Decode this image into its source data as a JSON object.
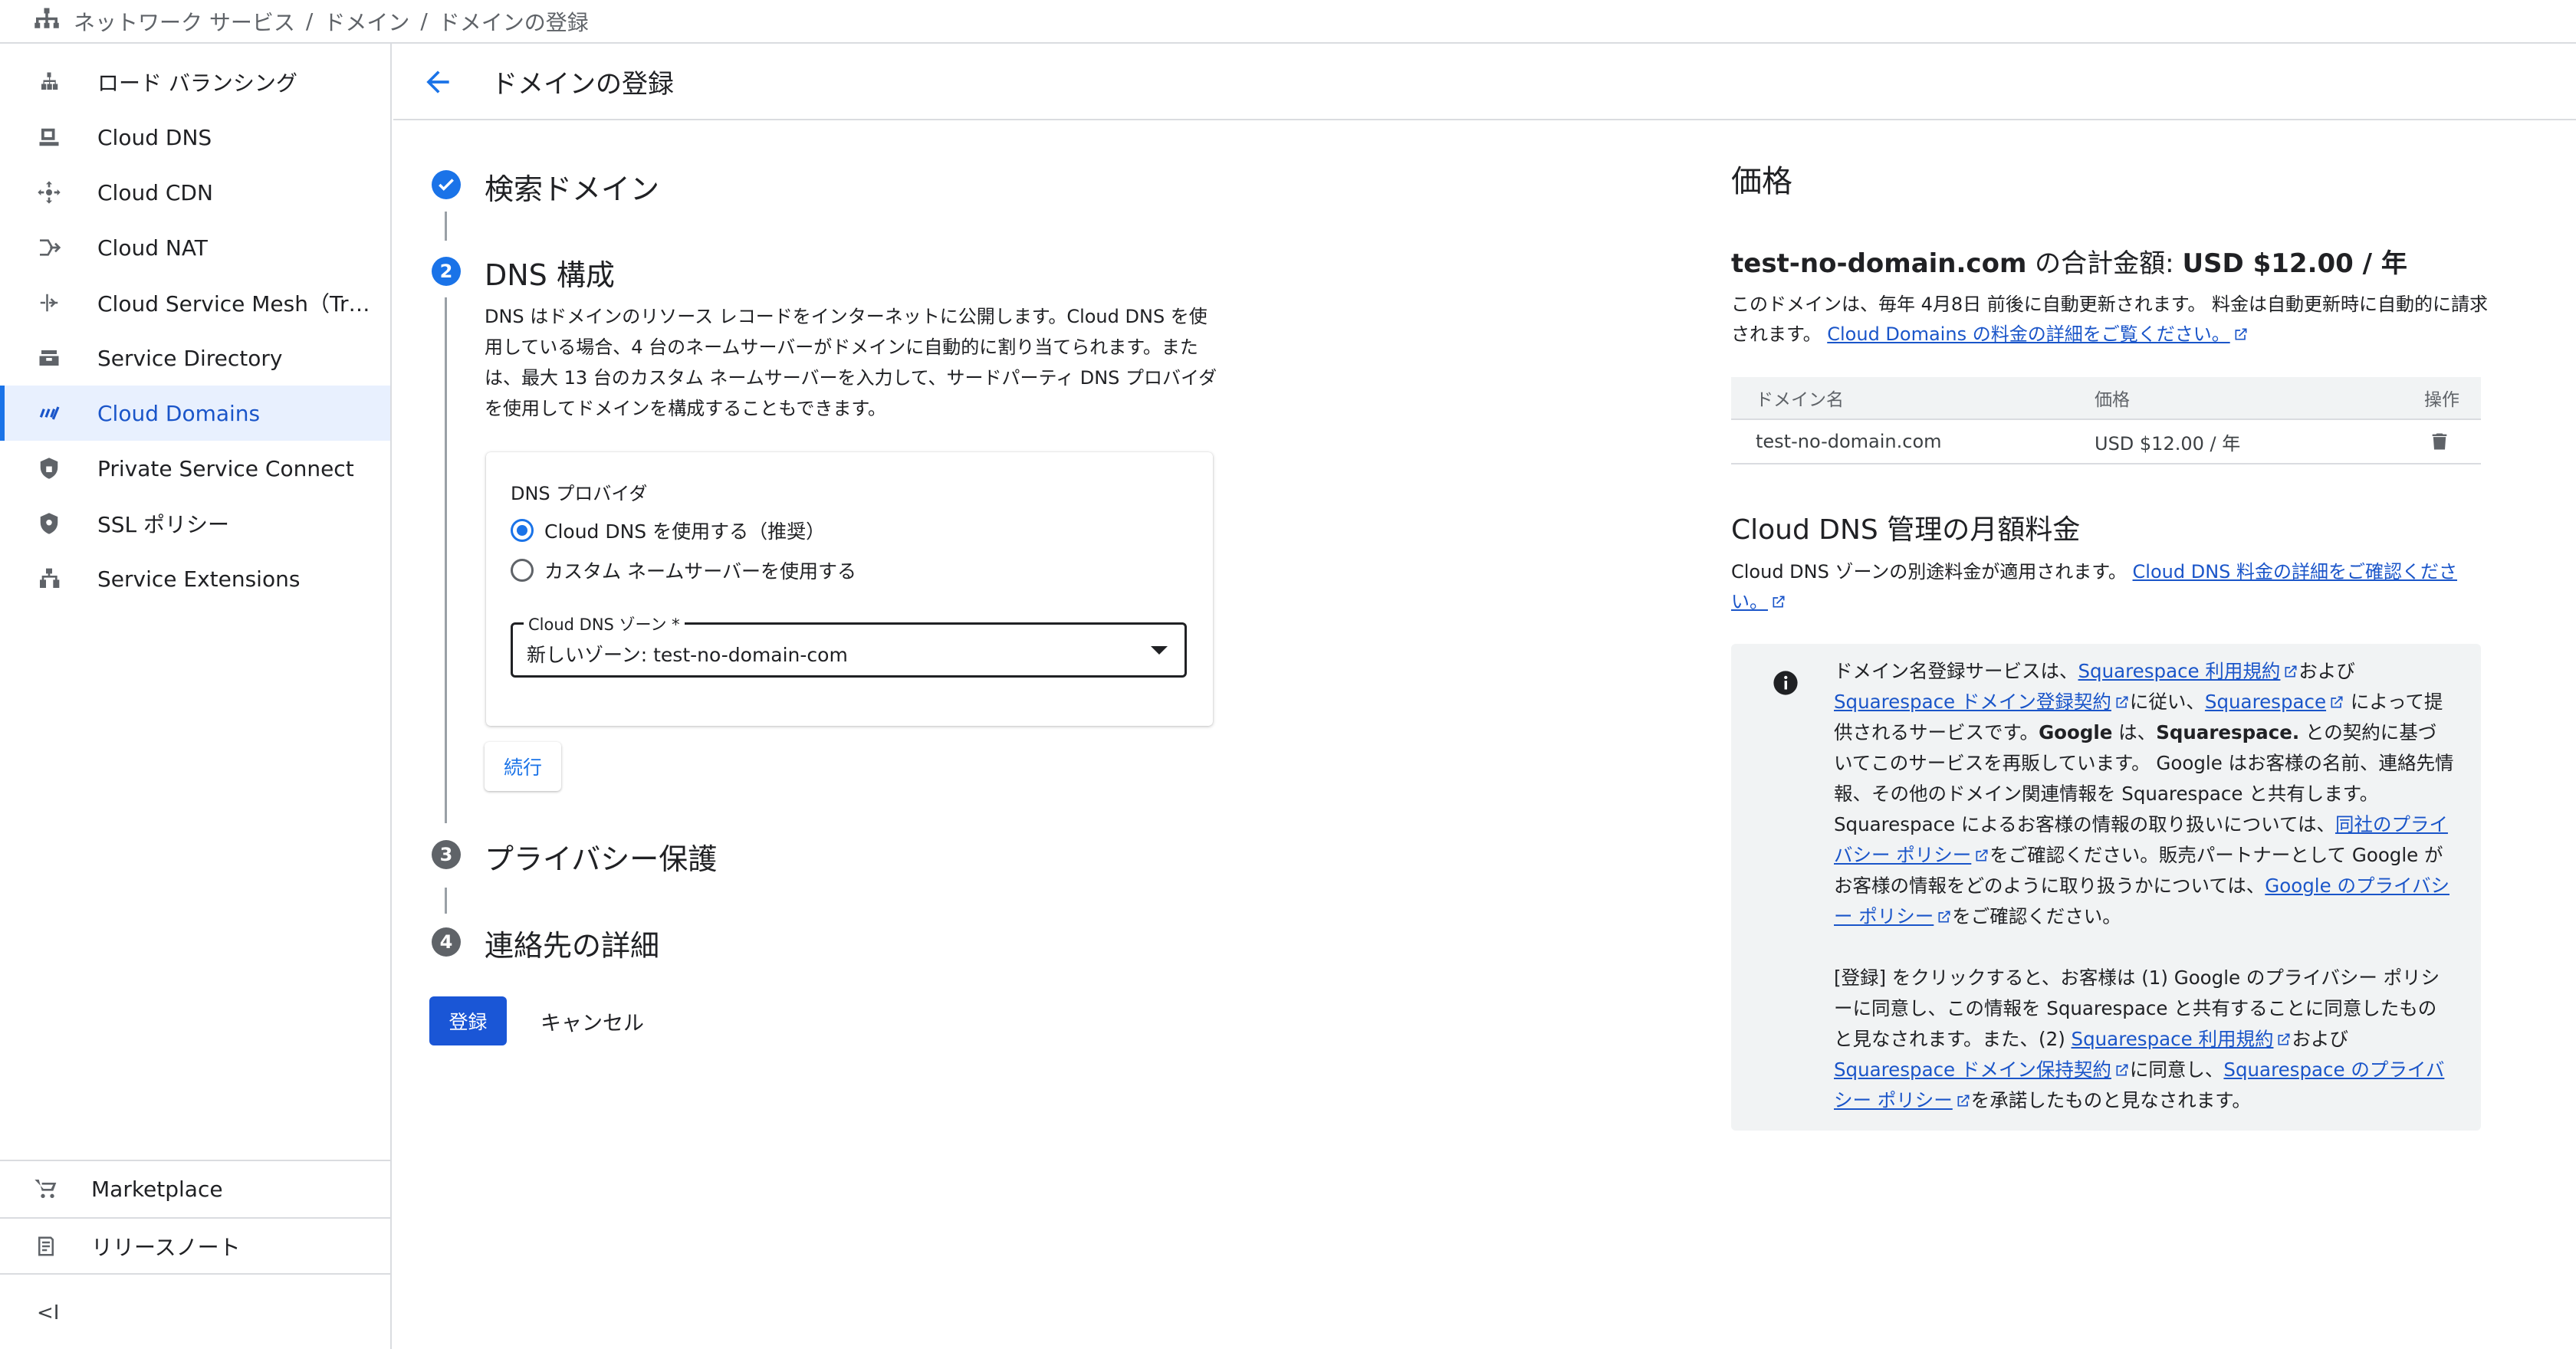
{
  "breadcrumb": [
    "ネットワーク サービス",
    "ドメイン",
    "ドメインの登録"
  ],
  "breadcrumb_sep": "/",
  "sidebar": {
    "items": [
      {
        "label": "ロード バランシング",
        "icon": "load-balancing-icon"
      },
      {
        "label": "Cloud DNS",
        "icon": "dns-icon"
      },
      {
        "label": "Cloud CDN",
        "icon": "cdn-icon"
      },
      {
        "label": "Cloud NAT",
        "icon": "nat-icon"
      },
      {
        "label": "Cloud Service Mesh（Traffic Director）",
        "icon": "service-mesh-icon"
      },
      {
        "label": "Service Directory",
        "icon": "service-directory-icon"
      },
      {
        "label": "Cloud Domains",
        "icon": "domains-icon",
        "active": true
      },
      {
        "label": "Private Service Connect",
        "icon": "lock-icon"
      },
      {
        "label": "SSL ポリシー",
        "icon": "shield-icon"
      },
      {
        "label": "Service Extensions",
        "icon": "extensions-icon"
      }
    ],
    "bottom": [
      {
        "label": "Marketplace",
        "icon": "cart-icon"
      },
      {
        "label": "リリースノート",
        "icon": "notes-icon"
      }
    ],
    "collapse_glyph": "<I"
  },
  "header": {
    "title": "ドメインの登録"
  },
  "stepper": {
    "steps": [
      {
        "num": "1",
        "title": "検索ドメイン",
        "state": "done"
      },
      {
        "num": "2",
        "title": "DNS 構成",
        "state": "active"
      },
      {
        "num": "3",
        "title": "プライバシー保護",
        "state": "pending"
      },
      {
        "num": "4",
        "title": "連絡先の詳細",
        "state": "pending"
      }
    ],
    "dns_description": "DNS はドメインのリソース レコードをインターネットに公開します。Cloud DNS を使用している場合、4 台のネームサーバーがドメインに自動的に割り当てられます。または、最大 13 台のカスタム ネームサーバーを入力して、サードパーティ DNS プロバイダを使用してドメインを構成することもできます。",
    "provider_label": "DNS プロバイダ",
    "options": [
      {
        "label": "Cloud DNS を使用する（推奨）",
        "selected": true
      },
      {
        "label": "カスタム ネームサーバーを使用する",
        "selected": false
      }
    ],
    "zone_label": "Cloud DNS ゾーン *",
    "zone_value": "新しいゾーン: test-no-domain-com",
    "continue_label": "続行"
  },
  "actions": {
    "register": "登録",
    "cancel": "キャンセル"
  },
  "pricing": {
    "heading": "価格",
    "domain": "test-no-domain.com",
    "total_mid": " の合計金額: ",
    "total_value": "USD $12.00 / 年",
    "renew_text": "このドメインは、毎年 4月8日 前後に自動更新されます。 料金は自動更新時に自動的に請求されます。",
    "renew_link": "Cloud Domains の料金の詳細をご覧ください。",
    "table": {
      "headers": [
        "ドメイン名",
        "価格",
        "操作"
      ],
      "rows": [
        {
          "domain": "test-no-domain.com",
          "price": "USD $12.00 / 年"
        }
      ]
    },
    "dns_heading": "Cloud DNS 管理の月額料金",
    "dns_text": "Cloud DNS ゾーンの別途料金が適用されます。",
    "dns_link": "Cloud DNS 料金の詳細をご確認ください。"
  },
  "notice": {
    "p1": [
      {
        "t": "ドメイン名登録サービスは、"
      },
      {
        "t": "Squarespace 利用規約",
        "link": true
      },
      {
        "t": "および "
      },
      {
        "t": "Squarespace ドメイン登録契約",
        "link": true
      },
      {
        "t": "に従い、"
      },
      {
        "t": "Squarespace",
        "link": true
      },
      {
        "t": " によって提供されるサービスです。"
      },
      {
        "t": "Google",
        "b": true
      },
      {
        "t": " は、"
      },
      {
        "t": "Squarespace.",
        "b": true
      },
      {
        "t": " との契約に基づいてこのサービスを再販しています。 Google はお客様の名前、連絡先情報、その他のドメイン関連情報を Squarespace と共有します。Squarespace によるお客様の情報の取り扱いについては、"
      },
      {
        "t": "同社のプライバシー ポリシー",
        "link": true
      },
      {
        "t": "をご確認ください。販売パートナーとして Google がお客様の情報をどのように取り扱うかについては、"
      },
      {
        "t": "Google のプライバシー ポリシー",
        "link": true
      },
      {
        "t": "をご確認ください。"
      }
    ],
    "p2": [
      {
        "t": "[登録] をクリックすると、お客様は (1) Google のプライバシー ポリシーに同意し、この情報を Squarespace と共有することに同意したものと見なされます。また、(2) "
      },
      {
        "t": "Squarespace 利用規約",
        "link": true
      },
      {
        "t": "および "
      },
      {
        "t": "Squarespace ドメイン保持契約",
        "link": true
      },
      {
        "t": "に同意し、"
      },
      {
        "t": "Squarespace のプライバシー ポリシー",
        "link": true
      },
      {
        "t": "を承諾したものと見なされます。"
      }
    ]
  },
  "colors": {
    "accent": "#1a73e8",
    "primary_button": "#1a56d6",
    "link": "#1a55c9",
    "active_bg": "#e8f0fe"
  }
}
